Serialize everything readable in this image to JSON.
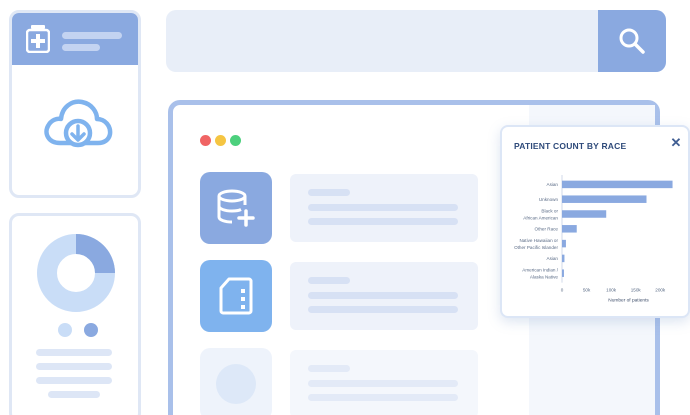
{
  "search": {
    "placeholder": ""
  },
  "chart_popup": {
    "close_glyph": "✕"
  },
  "chart_data": {
    "type": "bar",
    "orientation": "horizontal",
    "title": "PATIENT COUNT BY RACE",
    "xlabel": "Number of patients",
    "ylabel": "",
    "categories": [
      [
        "Asian"
      ],
      [
        "Unknown"
      ],
      [
        "Black or",
        "African American"
      ],
      [
        "Other Race"
      ],
      [
        "Native Hawaiian or",
        "Other Pacific Islander"
      ],
      [
        "Asian"
      ],
      [
        "American Indian /",
        "Alaska Native"
      ]
    ],
    "values": [
      225000,
      172000,
      90000,
      30000,
      8000,
      5000,
      4000
    ],
    "xlim": [
      0,
      230000
    ],
    "xticks": [
      0,
      50000,
      100000,
      150000,
      200000
    ],
    "xtick_labels": [
      "0",
      "50k",
      "100k",
      "150k",
      "200k"
    ],
    "grid": false,
    "legend": "none"
  },
  "colors": {
    "accent": "#8aa9e0",
    "accent_dark": "#3f5d92",
    "tile_blue": "#7fb3ee",
    "light_blue": "#c9ddf7",
    "bar": "#8aa9e0",
    "traffic_red": "#f06464",
    "traffic_yellow": "#f5c542",
    "traffic_green": "#4cd07d"
  }
}
